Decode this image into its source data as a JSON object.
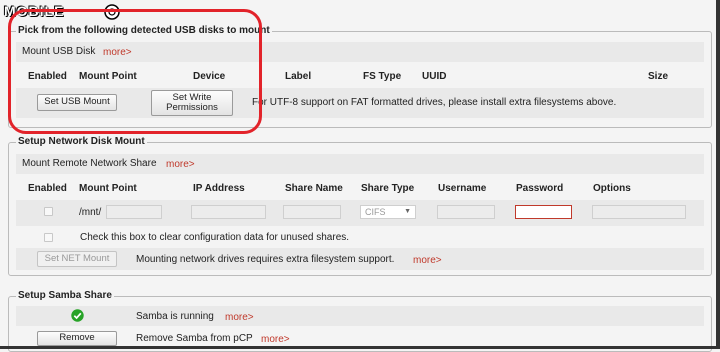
{
  "watermark": "MOBILE",
  "usb": {
    "legend": "Pick from the following detected USB disks to mount",
    "subheader": "Mount USB Disk",
    "more": "more>",
    "columns": [
      "Enabled",
      "Mount Point",
      "Device",
      "Label",
      "FS Type",
      "UUID",
      "Size"
    ],
    "set_usb_mount": "Set USB Mount",
    "set_write_permissions_line1": "Set Write",
    "set_write_permissions_line2": "Permissions",
    "utf8_note": "For UTF-8 support on FAT formatted drives, please install extra filesystems above."
  },
  "network": {
    "legend": "Setup Network Disk Mount",
    "subheader": "Mount Remote Network Share",
    "more": "more>",
    "columns": [
      "Enabled",
      "Mount Point",
      "IP Address",
      "Share Name",
      "Share Type",
      "Username",
      "Password",
      "Options"
    ],
    "mount_prefix": "/mnt/",
    "share_type_value": "CIFS",
    "clear_config_label": "Check this box to clear configuration data for unused shares.",
    "set_net_mount": "Set NET Mount",
    "net_note": "Mounting network drives requires extra filesystem support.",
    "net_more": "more>"
  },
  "samba": {
    "legend": "Setup Samba Share",
    "status": "Samba is running",
    "status_more": "more>",
    "remove_button": "Remove",
    "remove_label": "Remove Samba from pCP",
    "remove_more": "more>"
  },
  "colors": {
    "accent_red": "#c0392b",
    "annotation_red": "#e2232a",
    "status_green": "#27a327"
  }
}
